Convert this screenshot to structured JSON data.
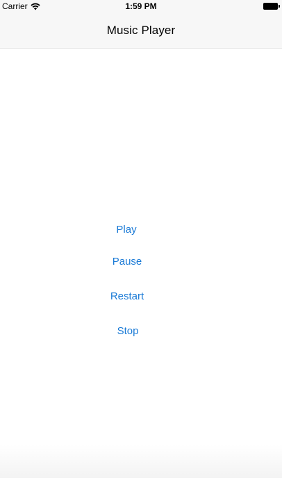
{
  "status_bar": {
    "carrier": "Carrier",
    "time": "1:59 PM",
    "icons": [
      "wifi-icon",
      "battery-icon"
    ]
  },
  "nav": {
    "title": "Music Player"
  },
  "controls": {
    "play_label": "Play",
    "pause_label": "Pause",
    "restart_label": "Restart",
    "stop_label": "Stop"
  },
  "colors": {
    "accent": "#1a7ad6",
    "bar_background": "#f7f7f7"
  }
}
